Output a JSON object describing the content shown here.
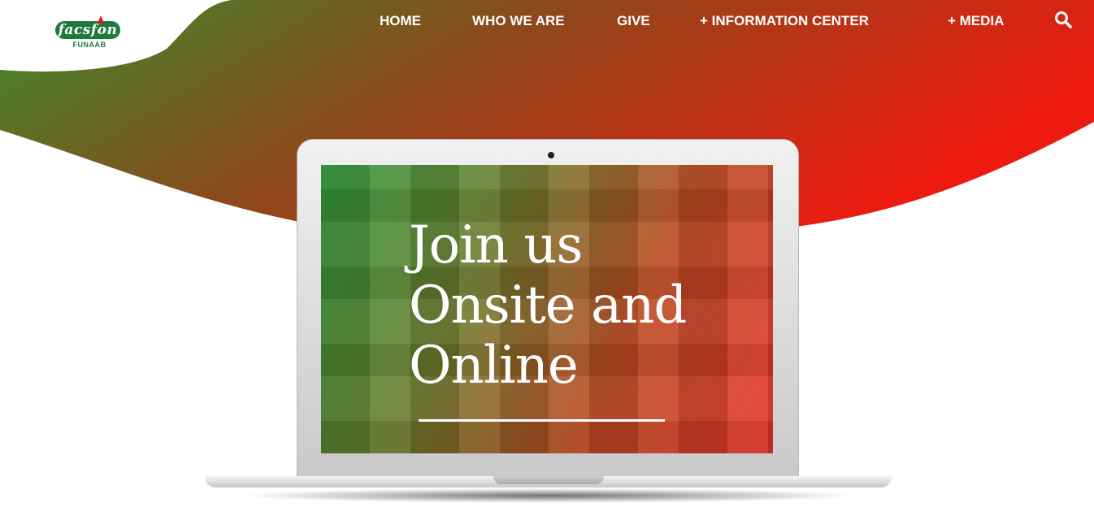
{
  "brand": {
    "logo_text": "facsfon",
    "logo_subtext": "FUNAAB"
  },
  "nav": {
    "items": [
      {
        "label": "HOME"
      },
      {
        "label": "WHO WE ARE"
      },
      {
        "label": "GIVE"
      },
      {
        "label": "+ INFORMATION CENTER"
      },
      {
        "label": "+ MEDIA"
      }
    ],
    "search_icon": "search-icon"
  },
  "hero": {
    "headline_line1": "Join us",
    "headline_line2": "Onsite and",
    "headline_line3": "Online"
  },
  "colors": {
    "gradient_start": "#3b8a2d",
    "gradient_end": "#ee1a10",
    "brand_green": "#1f7a3a",
    "text": "#ffffff"
  }
}
